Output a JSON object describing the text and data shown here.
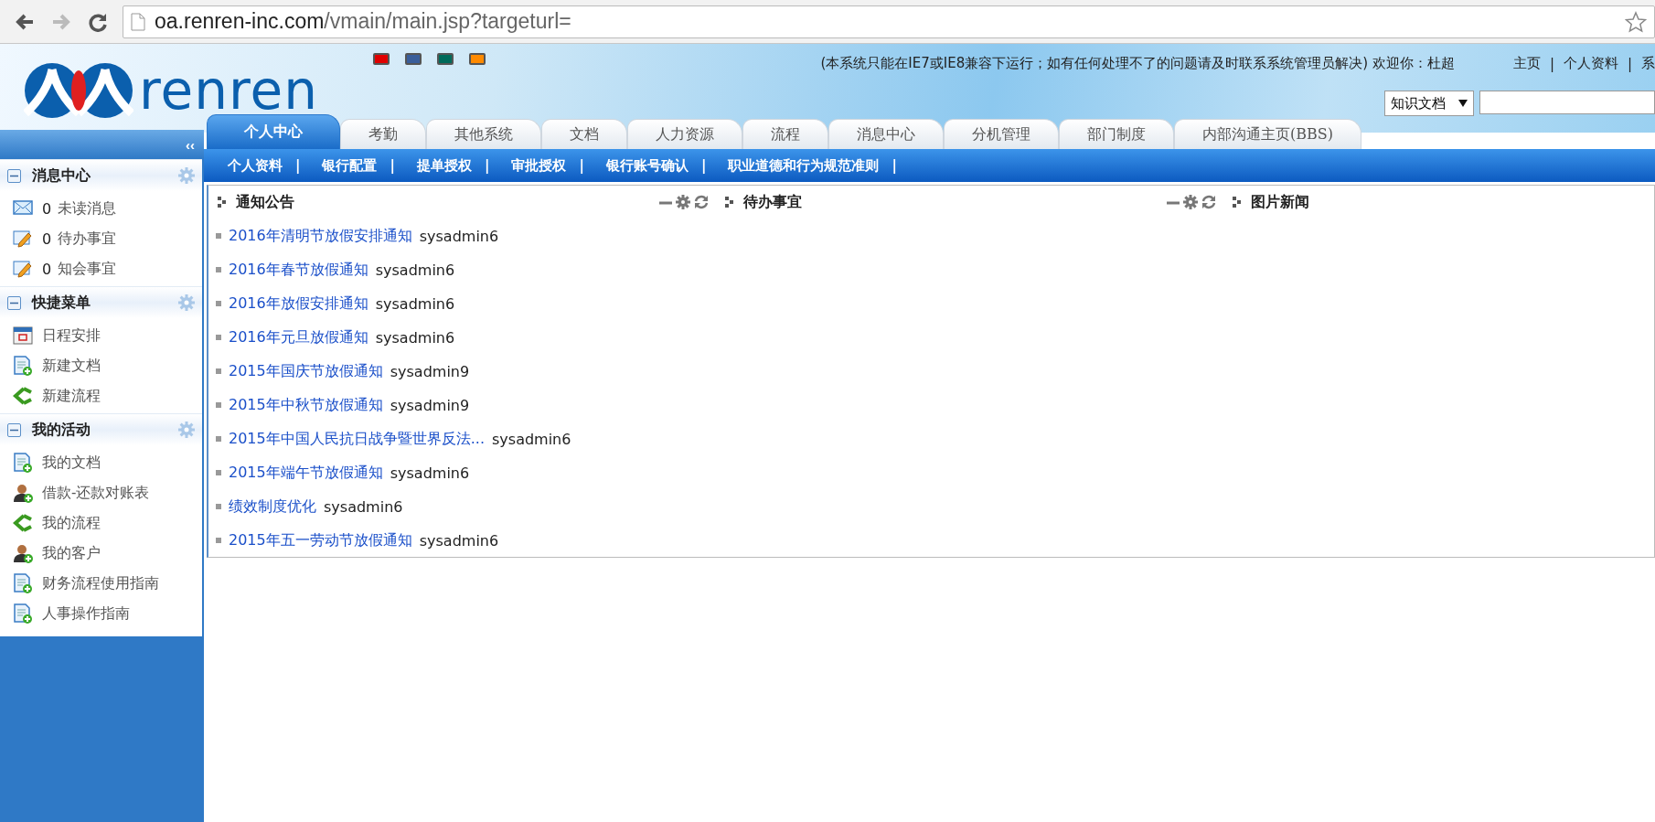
{
  "browser": {
    "url_host": "oa.renren-inc.com",
    "url_path": "/vmain/main.jsp?targeturl=",
    "forward_disabled": true
  },
  "header": {
    "logo_text": "renren",
    "themes": [
      {
        "color": "#e00000",
        "selected": false
      },
      {
        "color": "#3a5e9a",
        "selected": false
      },
      {
        "color": "#006a5a",
        "selected": false
      },
      {
        "color": "#ff8a00",
        "selected": false
      }
    ],
    "notice": "(本系统只能在IE7或IE8兼容下运行；如有任何处理不了的问题请及时联系系统管理员解决) 欢迎你：杜超",
    "links": [
      {
        "kind": "link",
        "text": "主页"
      },
      {
        "kind": "separator",
        "text": "|"
      },
      {
        "kind": "link",
        "text": "个人资料"
      },
      {
        "kind": "separator",
        "text": "|"
      },
      {
        "kind": "link",
        "text": "系"
      }
    ],
    "search_scope": "知识文档"
  },
  "sidebar": {
    "collapse": "‹‹",
    "sections": [
      {
        "title": "消息中心",
        "expanded": true,
        "items": [
          {
            "kind": "mail",
            "count": "0",
            "label": "未读消息"
          },
          {
            "kind": "edit",
            "count": "0",
            "label": "待办事宜"
          },
          {
            "kind": "edit",
            "count": "0",
            "label": "知会事宜"
          }
        ]
      },
      {
        "title": "快捷菜单",
        "expanded": true,
        "items": [
          {
            "kind": "calendar",
            "label": "日程安排"
          },
          {
            "kind": "doc",
            "label": "新建文档"
          },
          {
            "kind": "flow",
            "label": "新建流程"
          }
        ]
      },
      {
        "title": "我的活动",
        "expanded": true,
        "items": [
          {
            "kind": "doc",
            "label": "我的文档"
          },
          {
            "kind": "person",
            "label": "借款-还款对账表"
          },
          {
            "kind": "flow",
            "label": "我的流程"
          },
          {
            "kind": "person",
            "label": "我的客户"
          },
          {
            "kind": "doc",
            "label": "财务流程使用指南"
          },
          {
            "kind": "doc",
            "label": "人事操作指南"
          }
        ]
      }
    ]
  },
  "tabs": [
    {
      "label": "个人中心",
      "selected": true
    },
    {
      "label": "考勤",
      "selected": false
    },
    {
      "label": "其他系统",
      "selected": false
    },
    {
      "label": "文档",
      "selected": false
    },
    {
      "label": "人力资源",
      "selected": false
    },
    {
      "label": "流程",
      "selected": false
    },
    {
      "label": "消息中心",
      "selected": false
    },
    {
      "label": "分机管理",
      "selected": false
    },
    {
      "label": "部门制度",
      "selected": false
    },
    {
      "label": "内部沟通主页(BBS)",
      "selected": false
    }
  ],
  "subnav": [
    {
      "kind": "link",
      "text": "个人资料"
    },
    {
      "kind": "separator",
      "text": "|"
    },
    {
      "kind": "link",
      "text": "银行配置"
    },
    {
      "kind": "separator",
      "text": "|"
    },
    {
      "kind": "link",
      "text": "提单授权"
    },
    {
      "kind": "separator",
      "text": "|"
    },
    {
      "kind": "link",
      "text": "审批授权"
    },
    {
      "kind": "separator",
      "text": "|"
    },
    {
      "kind": "link",
      "text": "银行账号确认"
    },
    {
      "kind": "separator",
      "text": "|"
    },
    {
      "kind": "link",
      "text": "职业道德和行为规范准则"
    },
    {
      "kind": "separator",
      "text": "|"
    }
  ],
  "portlets": [
    {
      "title": "通知公告",
      "controls": true,
      "rows": [
        {
          "title": "2016年清明节放假安排通知",
          "author": "sysadmin6"
        },
        {
          "title": "2016年春节放假通知",
          "author": "sysadmin6"
        },
        {
          "title": "2016年放假安排通知",
          "author": "sysadmin6"
        },
        {
          "title": "2016年元旦放假通知",
          "author": "sysadmin6"
        },
        {
          "title": "2015年国庆节放假通知",
          "author": "sysadmin9"
        },
        {
          "title": "2015年中秋节放假通知",
          "author": "sysadmin9"
        },
        {
          "title": "2015年中国人民抗日战争暨世界反法...",
          "author": "sysadmin6"
        },
        {
          "title": "2015年端午节放假通知",
          "author": "sysadmin6"
        },
        {
          "title": "绩效制度优化",
          "author": "sysadmin6"
        },
        {
          "title": "2015年五一劳动节放假通知",
          "author": "sysadmin6"
        }
      ]
    },
    {
      "title": "待办事宜",
      "controls": true
    },
    {
      "title": "图片新闻",
      "controls": false
    }
  ]
}
